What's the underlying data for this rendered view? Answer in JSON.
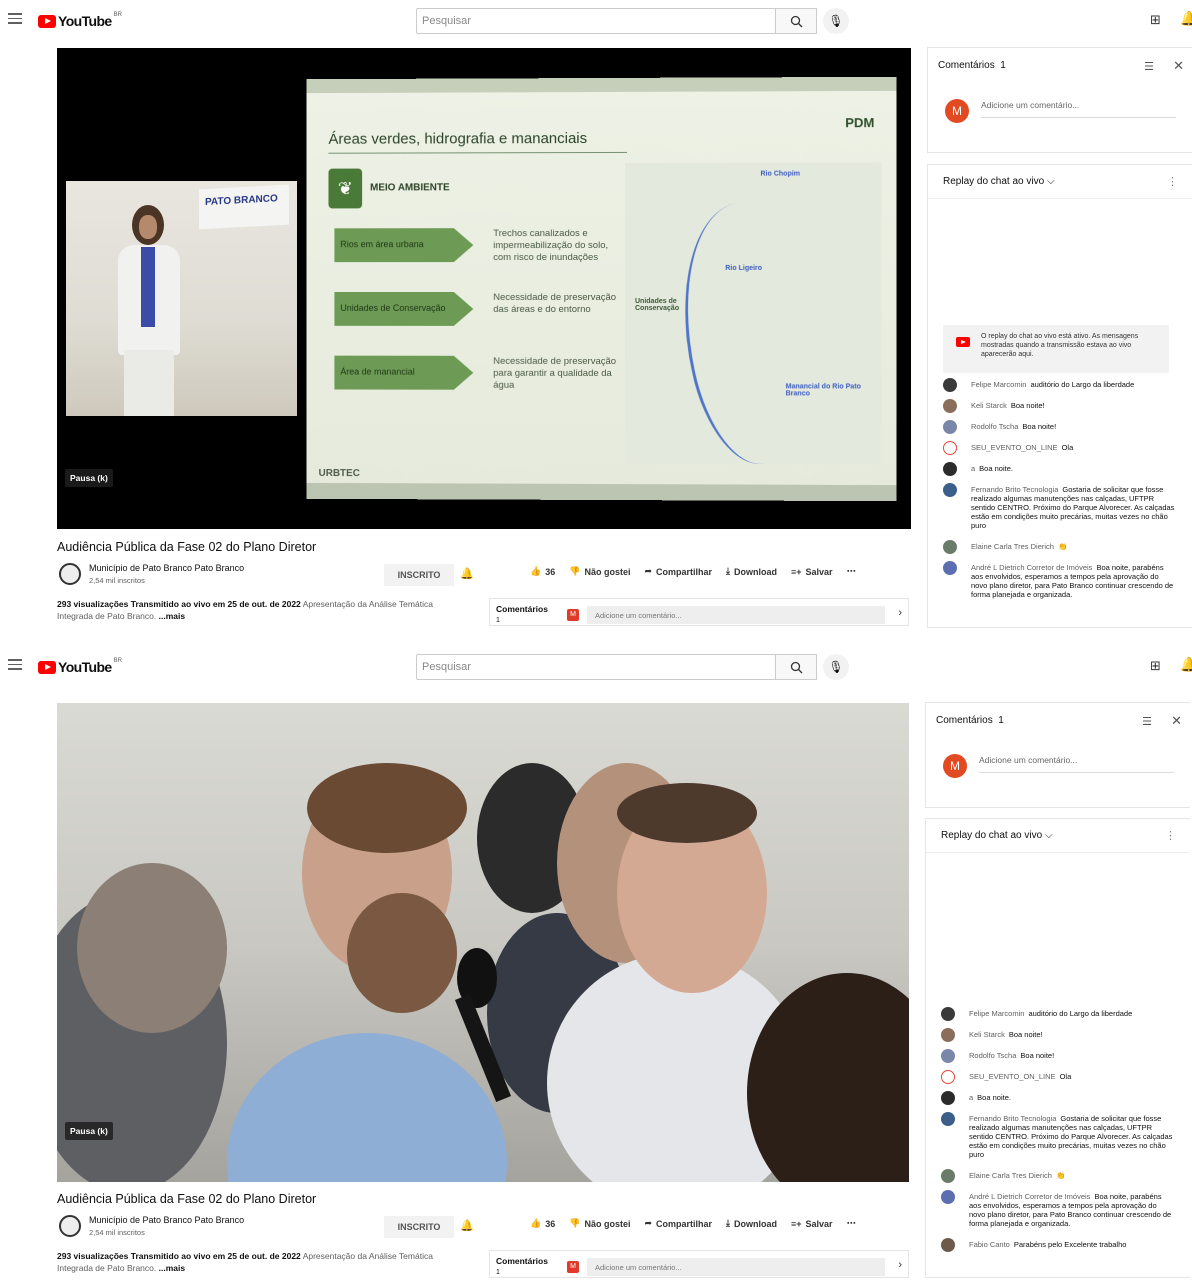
{
  "header": {
    "logo_text": "YouTube",
    "region": "BR",
    "search_placeholder": "Pesquisar"
  },
  "video": {
    "pause_label": "Pausa (k)",
    "title": "Audiência Pública da Fase 02 do Plano Diretor",
    "channel_name": "Município de Pato Branco Pato Branco",
    "subscribers": "2,54 mil inscritos",
    "subscribe_label": "INSCRITO",
    "likes": "36",
    "dislike_label": "Não gostei",
    "share_label": "Compartilhar",
    "download_label": "Download",
    "save_label": "Salvar",
    "views_line": "293 visualizações  Transmitido ao vivo em 25 de out. de 2022",
    "desc_rest": "Apresentação da Análise Temática",
    "desc_line2": "Integrada de Pato Branco.",
    "more_label": "...mais"
  },
  "slide": {
    "title": "Áreas verdes, hidrografia e mananciais",
    "brand": "PDM",
    "section": "MEIO AMBIENTE",
    "rows": [
      {
        "label": "Rios em área urbana",
        "desc": "Trechos canalizados e impermeabilização do solo, com risco de inundações"
      },
      {
        "label": "Unidades de Conservação",
        "desc": "Necessidade de preservação das áreas e do entorno"
      },
      {
        "label": "Área de manancial",
        "desc": "Necessidade de preservação para garantir a qualidade da água"
      }
    ],
    "map_labels": [
      "Rio Chopim",
      "Rio Ligeiro",
      "Unidades de Conservação",
      "Manancial do Rio Pato Branco"
    ],
    "footer": "URBTEC",
    "speaker_board": "PATO BRANCO"
  },
  "comments": {
    "title": "Comentários",
    "count": "1",
    "placeholder": "Adicione um comentário...",
    "avatar_letter": "M",
    "section_label": "Comentários",
    "section_count": "1"
  },
  "chat": {
    "header": "Replay do chat ao vivo",
    "notice": "O replay do chat ao vivo está ativo. As mensagens mostradas quando a transmissão estava ao vivo aparecerão aqui.",
    "messages": [
      {
        "author": "Felipe Marcomin",
        "text": "auditório do Largo da liberdade",
        "color": "#3a3a3a"
      },
      {
        "author": "Keli Starck",
        "text": "Boa noite!",
        "color": "#8a6d5a"
      },
      {
        "author": "Rodolfo Tscha",
        "text": "Boa noite!",
        "color": "#7a87a8"
      },
      {
        "author": "SEU_EVENTO_ON_LINE",
        "text": "Ola",
        "color": "#e0473a"
      },
      {
        "author": "a",
        "text": "Boa noite.",
        "color": "#2b2b2b"
      },
      {
        "author": "Fernando Brito Tecnologia",
        "text": "Gostaria de solicitar que fosse realizado algumas manutenções nas calçadas, UFTPR sentido CENTRO. Próximo do Parque Alvorecer. As calçadas estão em condições muito precárias, muitas vezes no chão puro",
        "color": "#3c5e8a"
      },
      {
        "author": "Elaine Carla Tres Dierich",
        "text": "👏",
        "color": "#6a7b6a"
      },
      {
        "author": "André L Dietrich Corretor de Imóveis",
        "text": "Boa noite, parabéns aos envolvidos, esperamos a tempos pela aprovação do novo plano diretor, para Pato Branco continuar crescendo de forma planejada e organizada.",
        "color": "#5b6fb0"
      },
      {
        "author": "Fabio Canto",
        "text": "Parabéns pelo Excelente trabalho",
        "color": "#6d5a4a"
      }
    ]
  }
}
